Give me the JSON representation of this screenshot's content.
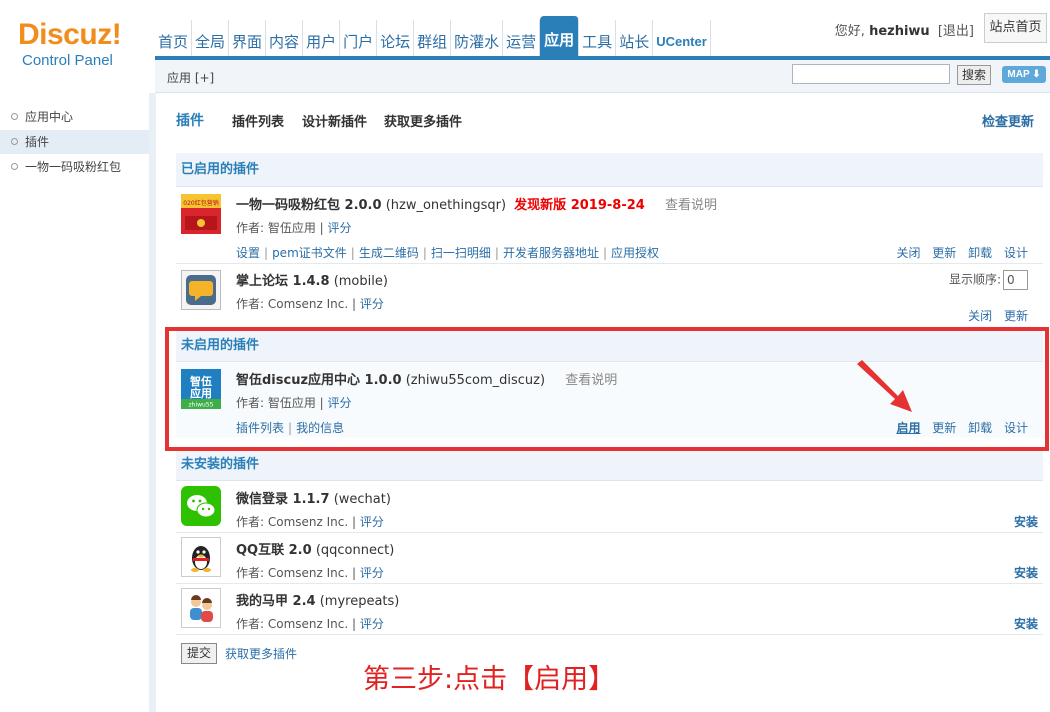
{
  "header": {
    "logo_main": "Discuz!",
    "logo_sub": "Control Panel",
    "nav": [
      {
        "label": "首页"
      },
      {
        "label": "全局"
      },
      {
        "label": "界面"
      },
      {
        "label": "内容"
      },
      {
        "label": "用户"
      },
      {
        "label": "门户"
      },
      {
        "label": "论坛"
      },
      {
        "label": "群组"
      },
      {
        "label": "防灌水"
      },
      {
        "label": "运营"
      },
      {
        "label": "应用"
      },
      {
        "label": "工具"
      },
      {
        "label": "站长"
      },
      {
        "label": "UCenter"
      }
    ],
    "greeting": "您好,",
    "username": "hezhiwu",
    "logout": "[退出]",
    "home_button": "站点首页"
  },
  "subbar": {
    "crumb": "应用 [+]",
    "search_value": "",
    "search_button": "搜索",
    "map_button": "MAP ⬇"
  },
  "sidebar": {
    "items": [
      {
        "label": "应用中心"
      },
      {
        "label": "插件"
      },
      {
        "label": "一物一码吸粉红包"
      }
    ]
  },
  "tabs": {
    "current": "插件",
    "items": [
      "插件列表",
      "设计新插件",
      "获取更多插件"
    ],
    "check_update": "检查更新"
  },
  "sections": {
    "enabled": "已启用的插件",
    "disabled": "未启用的插件",
    "not_installed": "未安装的插件"
  },
  "plugins": {
    "p1": {
      "name": "一物一码吸粉红包 2.0.0",
      "id": "(hzw_onethingsqr)",
      "new_version": "发现新版 2019-8-24",
      "desc": "查看说明",
      "author": "作者: 智伍应用",
      "rate": "评分",
      "icon_text": "020红包营销",
      "links": [
        "设置",
        "pem证书文件",
        "生成二维码",
        "扫一扫明细",
        "开发者服务器地址",
        "应用授权"
      ],
      "ops": [
        "关闭",
        "更新",
        "卸载",
        "设计"
      ]
    },
    "p2": {
      "name": "掌上论坛 1.4.8",
      "id": "(mobile)",
      "author": "作者: Comsenz Inc.",
      "rate": "评分",
      "order_label": "显示顺序:",
      "order_value": "0",
      "ops": [
        "关闭",
        "更新"
      ]
    },
    "p3": {
      "name": "智伍discuz应用中心 1.0.0",
      "id": "(zhiwu55com_discuz)",
      "desc": "查看说明",
      "author": "作者: 智伍应用",
      "rate": "评分",
      "icon_text": "智伍应用",
      "icon_sub": "zhiwu55",
      "links": [
        "插件列表",
        "我的信息"
      ],
      "ops": [
        "启用",
        "更新",
        "卸载",
        "设计"
      ]
    },
    "p4": {
      "name": "微信登录 1.1.7",
      "id": "(wechat)",
      "author": "作者: Comsenz Inc.",
      "rate": "评分",
      "install": "安装"
    },
    "p5": {
      "name": "QQ互联 2.0",
      "id": "(qqconnect)",
      "author": "作者: Comsenz Inc.",
      "rate": "评分",
      "install": "安装"
    },
    "p6": {
      "name": "我的马甲 2.4",
      "id": "(myrepeats)",
      "author": "作者: Comsenz Inc.",
      "rate": "评分",
      "install": "安装"
    }
  },
  "footer": {
    "submit": "提交",
    "more": "获取更多插件"
  },
  "annotation": "第三步:点击【启用】",
  "colors": {
    "brand_blue": "#2b7fb8",
    "logo_orange": "#f28c1c",
    "highlight_red": "#e53333"
  }
}
